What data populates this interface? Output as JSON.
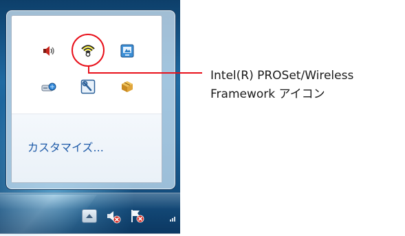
{
  "tray_popup": {
    "customize_label": "カスタマイズ...",
    "icons": [
      {
        "name": "volume-icon"
      },
      {
        "name": "wireless-signal-icon",
        "highlighted": true
      },
      {
        "name": "display-settings-icon"
      },
      {
        "name": "network-drive-icon"
      },
      {
        "name": "wrench-tool-icon"
      },
      {
        "name": "package-box-icon"
      }
    ]
  },
  "callout": {
    "line1": "Intel(R) PROSet/Wireless",
    "line2": "Framework アイコン",
    "highlight_color": "#e8101a"
  },
  "taskbar": {
    "show_hidden_icons_button": "chevron-up-icon",
    "status_icons": [
      "volume-muted-icon",
      "action-center-error-icon",
      "network-icon"
    ]
  },
  "colors": {
    "link": "#1e5aa8",
    "taskbar": "#1a5f95"
  }
}
